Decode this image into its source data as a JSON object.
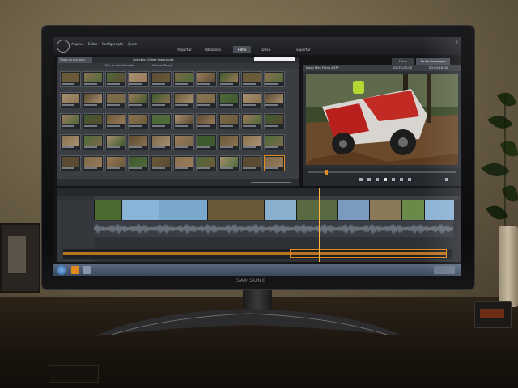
{
  "photo": {
    "tv_brand": "SAMSUNG"
  },
  "app": {
    "menu": [
      "Arquivo",
      "Editar",
      "Configuração",
      "Ajuda"
    ],
    "watermark": "X",
    "modes": [
      {
        "label": "Importar",
        "active": false
      },
      {
        "label": "Biblioteca",
        "active": false
      },
      {
        "label": "Filme",
        "active": true
      },
      {
        "label": "Disco",
        "active": false
      },
      {
        "label": "Exportar",
        "active": false
      }
    ],
    "library": {
      "tab": "Todos os recursos",
      "collection": "Coleções: Última Importação",
      "filter_label": "Filtro de classificação",
      "tags_label": "Marcas (Tags)"
    },
    "viewer": {
      "tabs": [
        {
          "label": "Fonte",
          "active": false
        },
        {
          "label": "Linha do tempo",
          "active": true
        }
      ],
      "title": "Novo Meu Filme.AXP*",
      "timecode_in": "01:32:03.00",
      "timecode_out": "00:03:16.00"
    }
  },
  "colors": {
    "accent": "#e08a20",
    "playhead": "#ffb640",
    "ui_dark": "#2e3136",
    "taskbar": "#4a5a70"
  }
}
